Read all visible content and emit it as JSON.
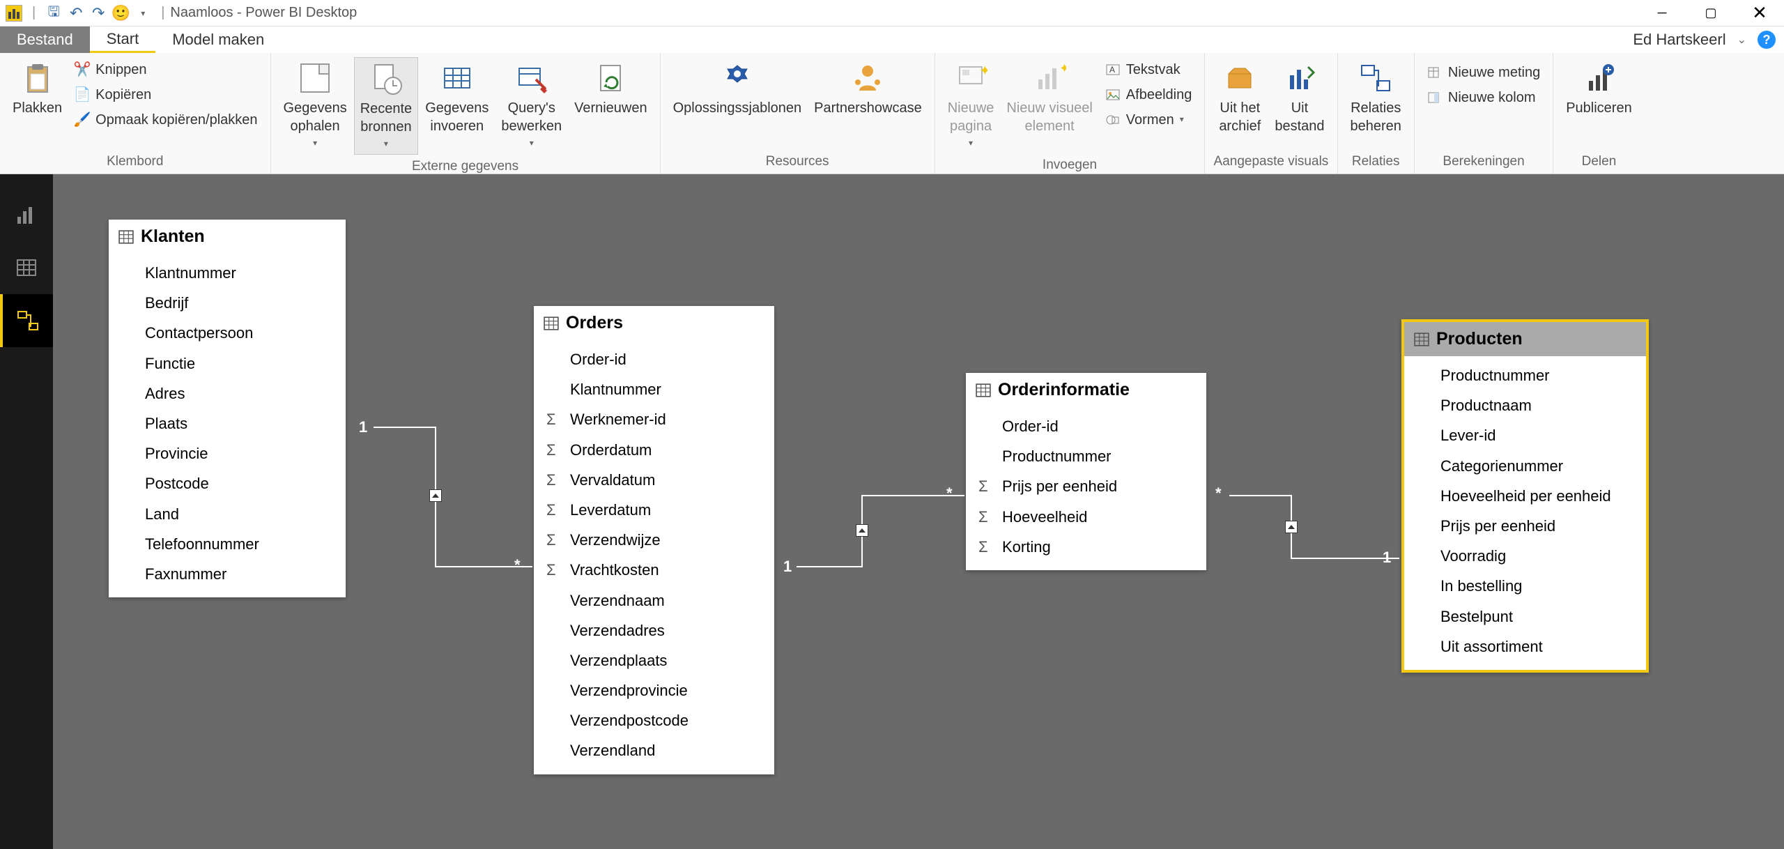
{
  "title": "Naamloos - Power BI Desktop",
  "user": "Ed Hartskeerl",
  "tabs": {
    "file": "Bestand",
    "home": "Start",
    "model": "Model maken"
  },
  "ribbon": {
    "clipboard": {
      "label": "Klembord",
      "paste": "Plakken",
      "cut": "Knippen",
      "copy": "Kopiëren",
      "format": "Opmaak kopiëren/plakken"
    },
    "external": {
      "label": "Externe gegevens",
      "get": "Gegevens\nophalen",
      "recent": "Recente\nbronnen",
      "enter": "Gegevens\ninvoeren",
      "edit": "Query's\nbewerken",
      "refresh": "Vernieuwen"
    },
    "resources": {
      "label": "Resources",
      "solutions": "Oplossingssjablonen",
      "partners": "Partnershowcase"
    },
    "insert": {
      "label": "Invoegen",
      "newpage": "Nieuwe\npagina",
      "newvisual": "Nieuw visueel\nelement",
      "textbox": "Tekstvak",
      "image": "Afbeelding",
      "shapes": "Vormen"
    },
    "customvis": {
      "label": "Aangepaste visuals",
      "archive": "Uit het\narchief",
      "file": "Uit\nbestand"
    },
    "relations": {
      "label": "Relaties",
      "manage": "Relaties\nbeheren"
    },
    "calc": {
      "label": "Berekeningen",
      "measure": "Nieuwe meting",
      "column": "Nieuwe kolom"
    },
    "share": {
      "label": "Delen",
      "publish": "Publiceren"
    }
  },
  "tables": {
    "klanten": {
      "name": "Klanten",
      "fields": [
        "Klantnummer",
        "Bedrijf",
        "Contactpersoon",
        "Functie",
        "Adres",
        "Plaats",
        "Provincie",
        "Postcode",
        "Land",
        "Telefoonnummer",
        "Faxnummer"
      ],
      "sigma": []
    },
    "orders": {
      "name": "Orders",
      "fields": [
        "Order-id",
        "Klantnummer",
        "Werknemer-id",
        "Orderdatum",
        "Vervaldatum",
        "Leverdatum",
        "Verzendwijze",
        "Vrachtkosten",
        "Verzendnaam",
        "Verzendadres",
        "Verzendplaats",
        "Verzendprovincie",
        "Verzendpostcode",
        "Verzendland"
      ],
      "sigma": [
        2,
        3,
        4,
        5,
        6,
        7
      ]
    },
    "orderinfo": {
      "name": "Orderinformatie",
      "fields": [
        "Order-id",
        "Productnummer",
        "Prijs per eenheid",
        "Hoeveelheid",
        "Korting"
      ],
      "sigma": [
        2,
        3,
        4
      ]
    },
    "producten": {
      "name": "Producten",
      "fields": [
        "Productnummer",
        "Productnaam",
        "Lever-id",
        "Categorienummer",
        "Hoeveelheid per eenheid",
        "Prijs per eenheid",
        "Voorradig",
        "In bestelling",
        "Bestelpunt",
        "Uit assortiment"
      ],
      "sigma": []
    }
  },
  "rel": {
    "one": "1",
    "many": "*"
  }
}
